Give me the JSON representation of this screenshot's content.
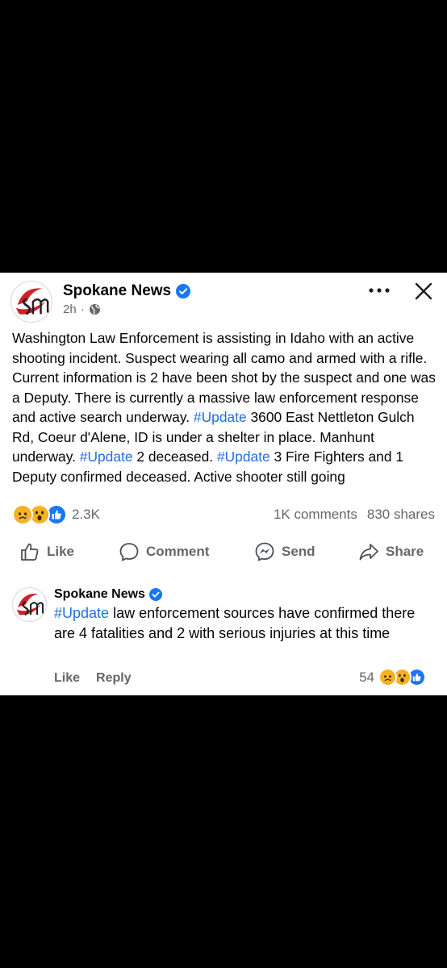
{
  "post": {
    "page_name": "Spokane News",
    "time": "2h",
    "time_separator": "·",
    "text": {
      "seg1": "Washington Law Enforcement is assisting in Idaho with an active shooting incident. Suspect wearing all camo and armed with a rifle. Current information is 2 have been shot by the suspect and one was a Deputy. There is currently a massive law enforcement response and active search underway. ",
      "tag1": "#Update",
      "seg2": " 3600 East Nettleton Gulch Rd, Coeur d'Alene, ID is under a shelter in place. Manhunt underway. ",
      "tag2": "#Update",
      "seg3": " 2 deceased. ",
      "tag3": "#Update",
      "seg4": " 3 Fire Fighters and 1 Deputy confirmed deceased. Active shooter still going"
    },
    "reaction_count": "2.3K",
    "comments_count": "1K comments",
    "shares_count": "830 shares"
  },
  "actions": {
    "like": "Like",
    "comment": "Comment",
    "send": "Send",
    "share": "Share"
  },
  "comment": {
    "author": "Spokane News",
    "tag": "#Update",
    "text": " law enforcement sources have confirmed there are 4 fatalities and 2 with serious injuries at this time",
    "like_label": "Like",
    "reply_label": "Reply",
    "reaction_count": "54"
  },
  "colors": {
    "background": "#000000",
    "card": "#ffffff",
    "hashtag": "#216fdb",
    "verified": "#1877f2",
    "secondary_text": "#65676b",
    "logo_red": "#d31f26"
  },
  "icons": [
    "verified-badge-icon",
    "globe-icon",
    "more-options-icon",
    "close-icon",
    "sad-reaction-icon",
    "wow-reaction-icon",
    "like-reaction-icon",
    "thumbs-up-icon",
    "comment-bubble-icon",
    "messenger-icon",
    "share-arrow-icon"
  ]
}
